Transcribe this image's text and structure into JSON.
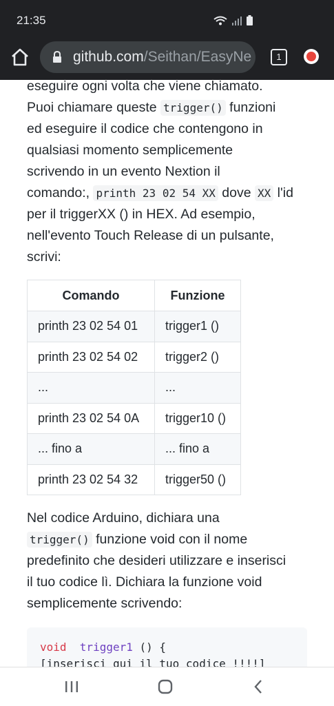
{
  "status": {
    "time": "21:35"
  },
  "browser": {
    "url_host": "github.com",
    "url_path": "/Seithan/EasyNe",
    "tab_count": "1"
  },
  "article": {
    "p1": {
      "line1": "eseguire ogni volta che viene chiamato.",
      "line2a": "Puoi chiamare queste ",
      "code_trigger": "trigger()",
      "line2b": " funzioni",
      "line3": "ed eseguire il codice che contengono in",
      "line4": "qualsiasi momento semplicemente",
      "line5": "scrivendo in un evento Nextion il",
      "line6a": "comando:, ",
      "code_printh": "printh 23 02 54 XX",
      "line6b": " dove ",
      "code_xx": "XX",
      "line6c": " l'id",
      "line7": "per il triggerXX () in HEX. Ad esempio,",
      "line8": "nell'evento Touch Release di un pulsante,",
      "line9": "scrivi:"
    },
    "table": {
      "headers": [
        "Comando",
        "Funzione"
      ],
      "rows": [
        [
          "printh 23 02 54 01",
          "trigger1 ()"
        ],
        [
          "printh 23 02 54 02",
          "trigger2 ()"
        ],
        [
          "...",
          "..."
        ],
        [
          "printh 23 02 54 0A",
          "trigger10 ()"
        ],
        [
          "... fino a",
          "... fino a"
        ],
        [
          "printh 23 02 54 32",
          "trigger50 ()"
        ]
      ]
    },
    "p2": {
      "line1": "Nel codice Arduino, dichiara una",
      "code_trigger": "trigger()",
      "line2b": " funzione void con il nome",
      "line3": "predefinito che desideri utilizzare e inserisci",
      "line4": "il tuo codice lì. Dichiara la funzione void",
      "line5": "semplicemente scrivendo:"
    },
    "code": {
      "kw_void": "void",
      "fn_name": "trigger1",
      "rest1": " () {",
      "line2": "[inserisci qui il tuo codice !!!!]"
    }
  }
}
